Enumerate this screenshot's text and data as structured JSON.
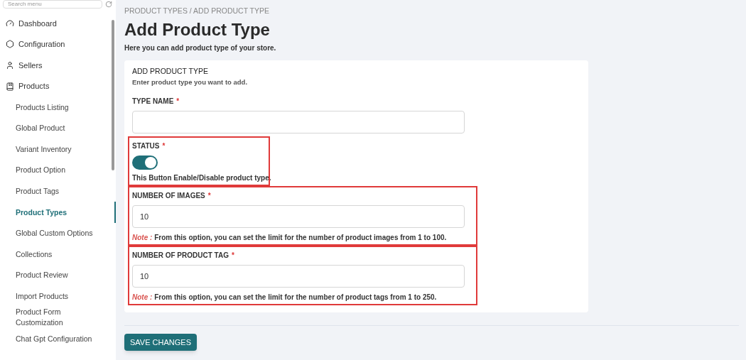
{
  "sidebar": {
    "search": {
      "placeholder": "Search menu"
    },
    "items": [
      {
        "label": "Dashboard",
        "selected": false
      },
      {
        "label": "Configuration",
        "selected": false
      },
      {
        "label": "Sellers",
        "selected": false
      },
      {
        "label": "Products",
        "selected": false,
        "children": [
          {
            "label": "Products Listing",
            "selected": false
          },
          {
            "label": "Global Product",
            "selected": false
          },
          {
            "label": "Variant Inventory",
            "selected": false
          },
          {
            "label": "Product Option",
            "selected": false
          },
          {
            "label": "Product Tags",
            "selected": false
          },
          {
            "label": "Product Types",
            "selected": true
          },
          {
            "label": "Global Custom Options",
            "selected": false
          },
          {
            "label": "Collections",
            "selected": false
          },
          {
            "label": "Product Review",
            "selected": false
          },
          {
            "label": "Import Products",
            "selected": false
          },
          {
            "label": "Product Form Customization",
            "selected": false
          },
          {
            "label": "Chat Gpt Configuration",
            "selected": false
          }
        ]
      }
    ]
  },
  "breadcrumb": "PRODUCT TYPES / ADD PRODUCT TYPE",
  "title": "Add Product Type",
  "subtitle": "Here you can add product type of your store.",
  "card": {
    "title": "ADD PRODUCT TYPE",
    "description": "Enter product type you want to add.",
    "fields": [
      {
        "kind": "text",
        "label": "TYPE NAME",
        "required": "*",
        "highlighted": false
      },
      {
        "kind": "toggle",
        "label": "STATUS",
        "required": "*",
        "on": true,
        "help": "This Button Enable/Disable product type.",
        "highlighted": true
      },
      {
        "kind": "text",
        "label": "NUMBER OF IMAGES",
        "required": "*",
        "value": "10",
        "note_label": "Note :",
        "note": "From this option, you can set the limit for the number of product images from 1 to 100.",
        "highlighted": true
      },
      {
        "kind": "text",
        "label": "NUMBER OF PRODUCT TAG",
        "required": "*",
        "value": "10",
        "note_label": "Note :",
        "note": "From this option, you can set the limit for the number of product tags from 1 to 250.",
        "highlighted": true
      }
    ]
  },
  "save_button": "SAVE CHANGES"
}
